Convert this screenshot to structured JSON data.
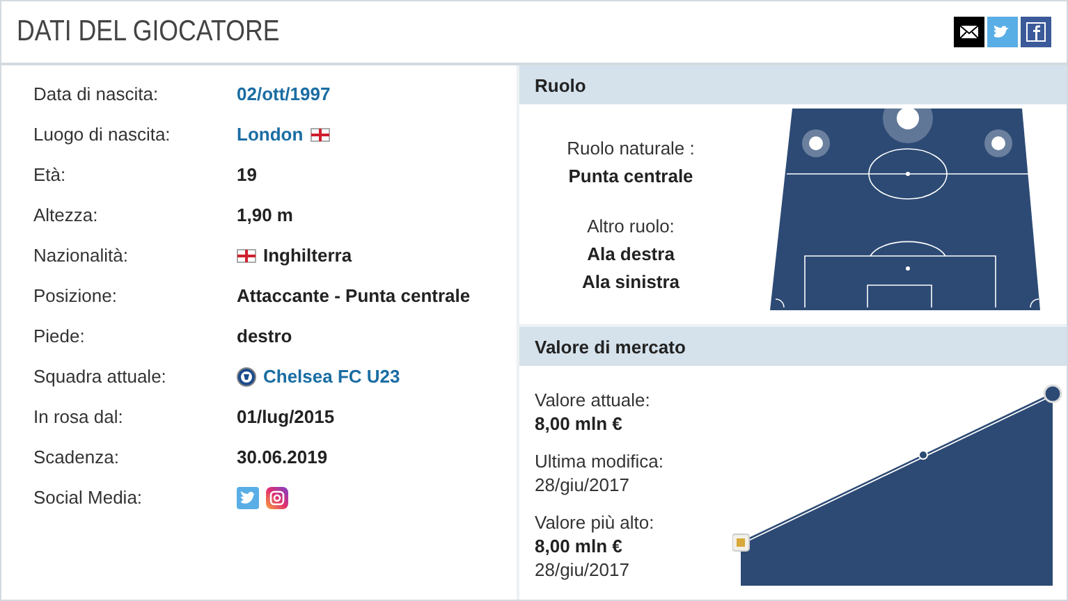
{
  "header": {
    "title": "DATI DEL GIOCATORE"
  },
  "share_buttons": [
    {
      "kind": "email"
    },
    {
      "kind": "twitter"
    },
    {
      "kind": "facebook"
    }
  ],
  "details": [
    {
      "label": "Data di nascita:",
      "value": "02/ott/1997",
      "kind": "link"
    },
    {
      "label": "Luogo di nascita:",
      "value": "London",
      "kind": "link",
      "flag_after": true
    },
    {
      "label": "Età:",
      "value": "19",
      "kind": "text"
    },
    {
      "label": "Altezza:",
      "value": "1,90 m",
      "kind": "text"
    },
    {
      "label": "Nazionalità:",
      "value": "Inghilterra",
      "kind": "text",
      "flag_before": true
    },
    {
      "label": "Posizione:",
      "value": "Attaccante - Punta centrale",
      "kind": "text"
    },
    {
      "label": "Piede:",
      "value": "destro",
      "kind": "text"
    },
    {
      "label": "Squadra attuale:",
      "value": "Chelsea FC U23",
      "kind": "link",
      "crest": true
    },
    {
      "label": "In rosa dal:",
      "value": "01/lug/2015",
      "kind": "text"
    },
    {
      "label": "Scadenza:",
      "value": "30.06.2019",
      "kind": "text"
    },
    {
      "label": "Social Media:",
      "kind": "social"
    }
  ],
  "role": {
    "title": "Ruolo",
    "natural_label": "Ruolo naturale :",
    "natural": "Punta centrale",
    "other_label": "Altro ruolo:",
    "other": [
      "Ala destra",
      "Ala sinistra"
    ]
  },
  "market": {
    "title": "Valore di mercato",
    "items": [
      {
        "label": "Valore attuale:",
        "value": "8,00 mln €"
      },
      {
        "label": "Ultima modifica:",
        "date": "28/giu/2017"
      },
      {
        "label": "Valore più alto:",
        "value": "8,00 mln €",
        "date": "28/giu/2017"
      }
    ]
  }
}
